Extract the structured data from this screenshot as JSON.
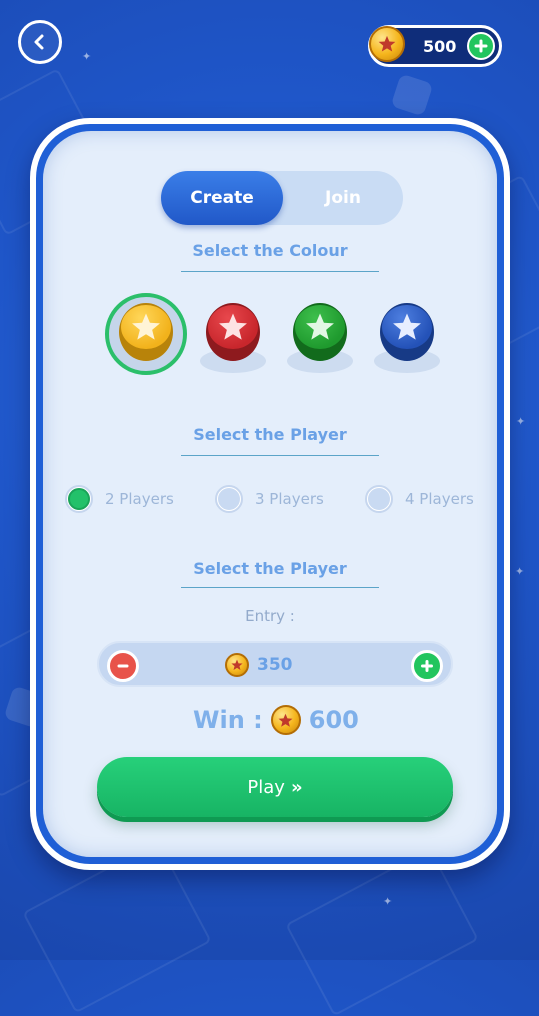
{
  "header": {
    "back_icon": "arrow-left-icon",
    "coin_balance": "500",
    "add_coins_icon": "plus-icon"
  },
  "tabs": [
    {
      "label": "Create",
      "active": true
    },
    {
      "label": "Join",
      "active": false
    }
  ],
  "colour_section": {
    "title": "Select the Colour",
    "tokens": [
      {
        "name": "yellow",
        "color": "#f2b21b",
        "selected": true
      },
      {
        "name": "red",
        "color": "#c8262c",
        "selected": false
      },
      {
        "name": "green",
        "color": "#1f9a2e",
        "selected": false
      },
      {
        "name": "blue",
        "color": "#2452b8",
        "selected": false
      }
    ]
  },
  "player_section": {
    "title": "Select the Player",
    "options": [
      {
        "label": "2 Players",
        "selected": true
      },
      {
        "label": "3 Players",
        "selected": false
      },
      {
        "label": "4 Players",
        "selected": false
      }
    ]
  },
  "entry_section": {
    "title": "Select the Player",
    "entry_label": "Entry :",
    "entry_value": "350"
  },
  "win": {
    "label": "Win :",
    "value": "600"
  },
  "play_button": {
    "label": "Play",
    "chevron": "»"
  },
  "colors": {
    "accent_green": "#22c55e",
    "accent_blue": "#2158c8",
    "minus_red": "#e8534a"
  }
}
